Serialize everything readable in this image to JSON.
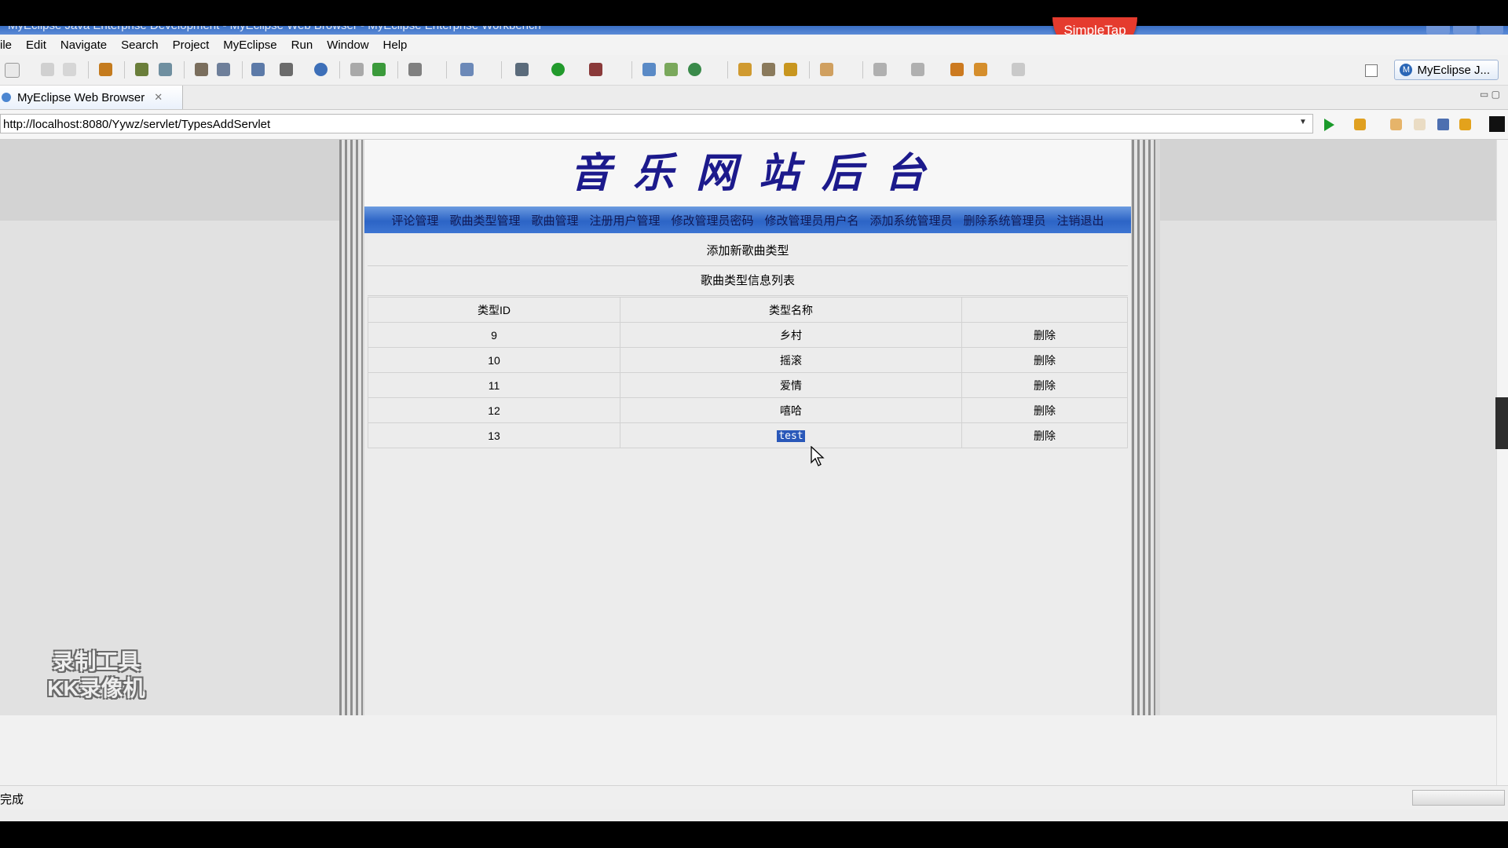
{
  "window": {
    "title": "MyEclipse Java Enterprise Development - MyEclipse Web Browser - MyEclipse Enterprise Workbench",
    "overlay_badge": "SimpleTap"
  },
  "menu": {
    "items": [
      "ile",
      "Edit",
      "Navigate",
      "Search",
      "Project",
      "MyEclipse",
      "Run",
      "Window",
      "Help"
    ]
  },
  "toolbar": {
    "perspective_label": "MyEclipse J...",
    "perspective_icon_letter": "M"
  },
  "editor_tab": {
    "label": "MyEclipse Web Browser",
    "close": "✕"
  },
  "browser": {
    "url": "http://localhost:8080/Yywz/servlet/TypesAddServlet",
    "status": "完成"
  },
  "site": {
    "title": "音乐网站后台",
    "nav": [
      "评论管理",
      "歌曲类型管理",
      "歌曲管理",
      "注册用户管理",
      "修改管理员密码",
      "修改管理员用户名",
      "添加系统管理员",
      "删除系统管理员",
      "注销退出"
    ],
    "add_link": "添加新歌曲类型",
    "list_title": "歌曲类型信息列表",
    "table": {
      "headers": [
        "类型ID",
        "类型名称",
        ""
      ],
      "rows": [
        {
          "id": "9",
          "name": "乡村",
          "action": "删除"
        },
        {
          "id": "10",
          "name": "摇滚",
          "action": "删除"
        },
        {
          "id": "11",
          "name": "爱情",
          "action": "删除"
        },
        {
          "id": "12",
          "name": "嘻哈",
          "action": "删除"
        },
        {
          "id": "13",
          "name": "test",
          "action": "删除"
        }
      ]
    }
  },
  "watermark": {
    "line1": "录制工具",
    "line2": "KK录像机"
  },
  "colors": {
    "nav_bar": "#2c64c6",
    "title_text": "#1c1a8c",
    "selection": "#2a58b9",
    "badge": "#e53b2e"
  }
}
